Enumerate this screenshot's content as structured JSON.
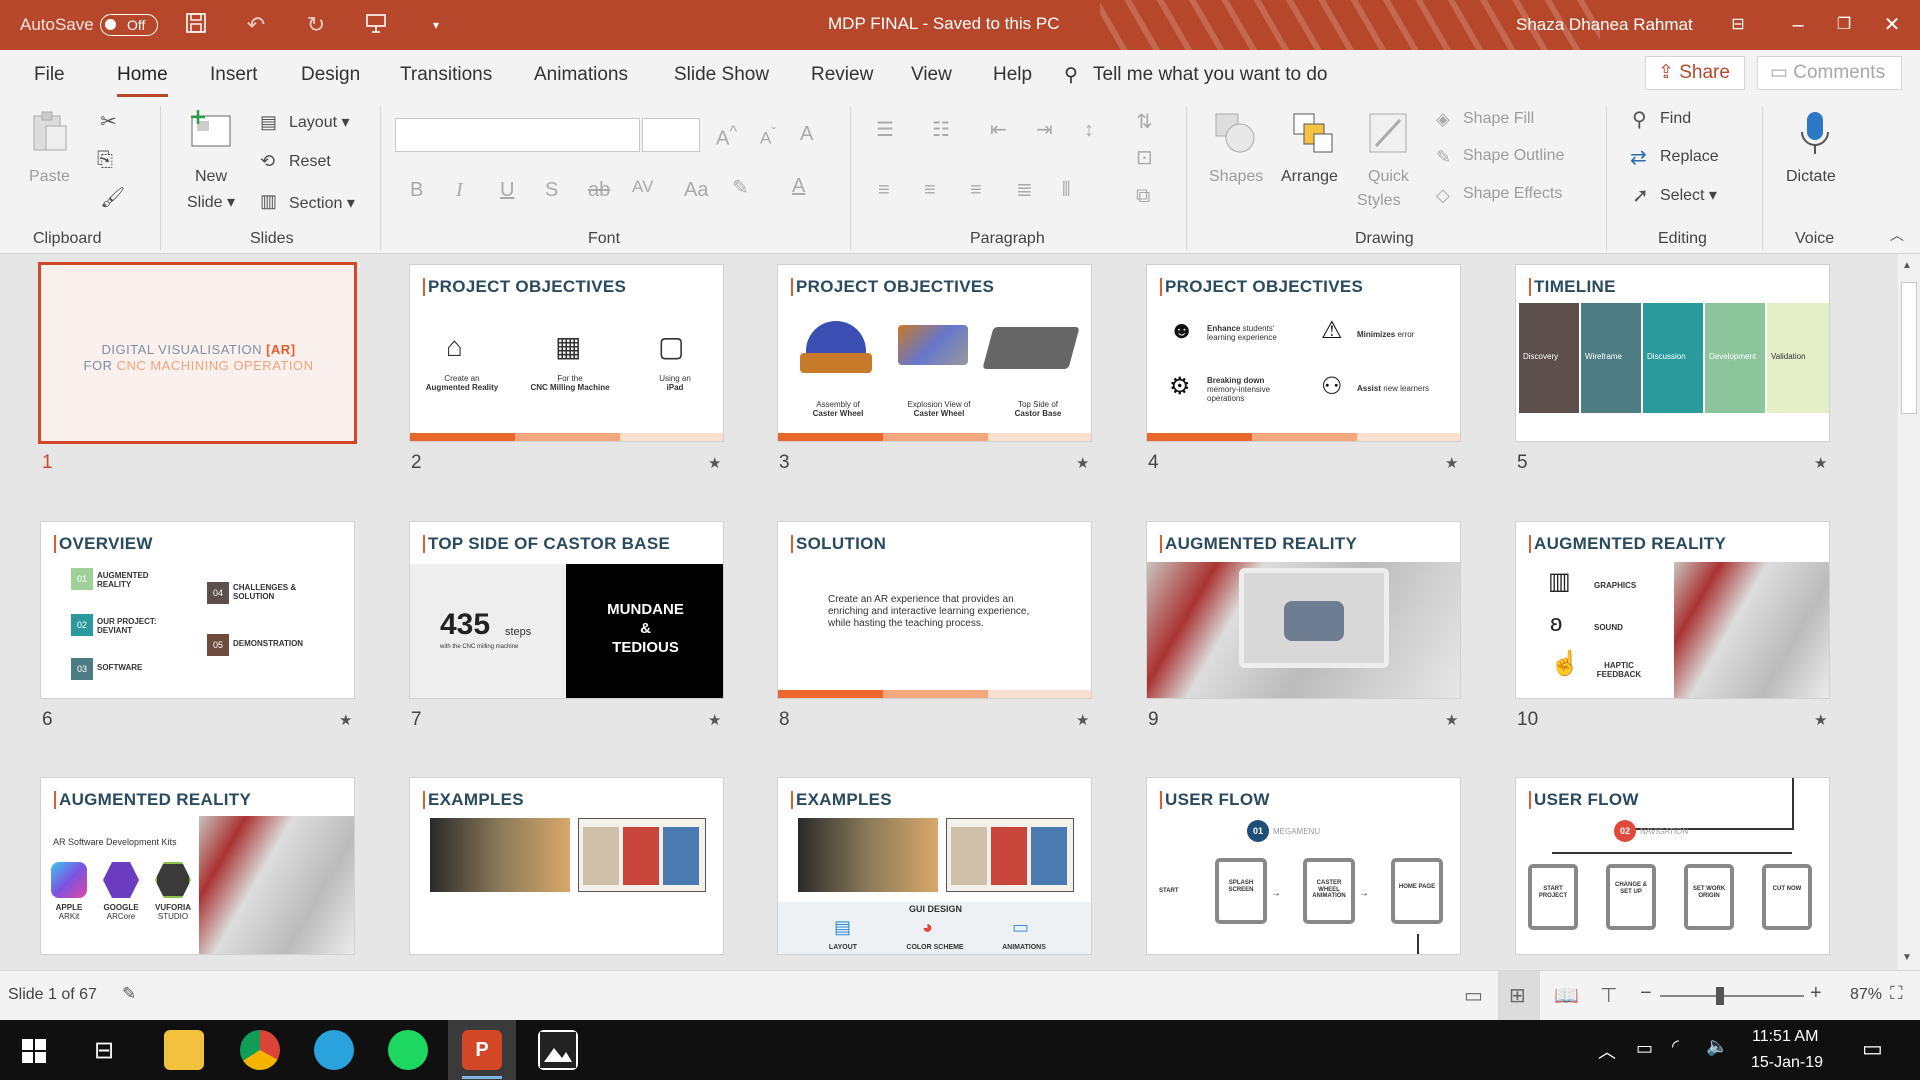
{
  "titlebar": {
    "autosave_label": "AutoSave",
    "autosave_state": "Off",
    "document_title": "MDP FINAL  -  Saved to this PC",
    "user_name": "Shaza Dhanea Rahmat",
    "bg_color": "#b7472a"
  },
  "menu": {
    "tabs": [
      "File",
      "Home",
      "Insert",
      "Design",
      "Transitions",
      "Animations",
      "Slide Show",
      "Review",
      "View",
      "Help"
    ],
    "active_tab": "Home",
    "tell_me": "Tell me what you want to do",
    "share": "Share",
    "comments": "Comments"
  },
  "ribbon": {
    "clipboard": {
      "paste": "Paste",
      "group": "Clipboard"
    },
    "slides": {
      "new_slide_1": "New",
      "new_slide_2": "Slide",
      "layout": "Layout",
      "reset": "Reset",
      "section": "Section",
      "group": "Slides"
    },
    "font": {
      "bold": "B",
      "italic": "I",
      "underline": "U",
      "shadow": "S",
      "strike": "ab",
      "group": "Font"
    },
    "paragraph": {
      "group": "Paragraph"
    },
    "drawing": {
      "shapes": "Shapes",
      "arrange": "Arrange",
      "quick_styles_1": "Quick",
      "quick_styles_2": "Styles",
      "shape_fill": "Shape Fill",
      "shape_outline": "Shape Outline",
      "shape_effects": "Shape Effects",
      "group": "Drawing"
    },
    "editing": {
      "find": "Find",
      "replace": "Replace",
      "select": "Select",
      "group": "Editing"
    },
    "voice": {
      "dictate": "Dictate",
      "group": "Voice"
    }
  },
  "slides": [
    {
      "num": "1",
      "line1a": "DIGITAL VISUALISATION ",
      "line1b": "[AR]",
      "line2a": "FOR ",
      "line2b": "CNC MACHINING OPERATION"
    },
    {
      "num": "2",
      "title": "PROJECT OBJECTIVES",
      "items": [
        [
          "Create an",
          "Augmented Reality"
        ],
        [
          "For the",
          "CNC Milling Machine"
        ],
        [
          "Using an",
          "iPad"
        ]
      ]
    },
    {
      "num": "3",
      "title": "PROJECT OBJECTIVES",
      "items": [
        [
          "Assembly of",
          "Caster Wheel"
        ],
        [
          "Explosion View of",
          "Caster Wheel"
        ],
        [
          "Top Side of",
          "Castor Base"
        ]
      ]
    },
    {
      "num": "4",
      "title": "PROJECT OBJECTIVES",
      "items": [
        [
          "Enhance",
          " students' learning experience"
        ],
        [
          "Minimizes",
          " error"
        ],
        [
          "Breaking down",
          " memory-intensive operations"
        ],
        [
          "Assist",
          " new learners"
        ]
      ]
    },
    {
      "num": "5",
      "title": "TIMELINE",
      "items": [
        "Discovery",
        "Wireframe",
        "Discussion",
        "Development",
        "Validation"
      ]
    },
    {
      "num": "6",
      "title": "OVERVIEW",
      "items": [
        [
          "01",
          "AUGMENTED REALITY"
        ],
        [
          "02",
          "OUR PROJECT: DEVIANT"
        ],
        [
          "03",
          "SOFTWARE"
        ],
        [
          "04",
          "CHALLENGES & SOLUTION"
        ],
        [
          "05",
          "DEMONSTRATION"
        ]
      ]
    },
    {
      "num": "7",
      "title": "TOP SIDE OF CASTOR BASE",
      "big": "435",
      "unit": "steps",
      "sub": "with the CNC milling machine",
      "right1": "MUNDANE",
      "right2": "&",
      "right3": "TEDIOUS"
    },
    {
      "num": "8",
      "title": "SOLUTION",
      "text": "Create an AR experience that provides an enriching and interactive learning experience, while hasting the teaching process."
    },
    {
      "num": "9",
      "title": "AUGMENTED REALITY"
    },
    {
      "num": "10",
      "title": "AUGMENTED REALITY",
      "items": [
        "GRAPHICS",
        "SOUND",
        "HAPTIC FEEDBACK"
      ]
    },
    {
      "num": "11",
      "title": "AUGMENTED REALITY",
      "kits": "AR Software Development Kits",
      "items": [
        [
          "APPLE",
          "ARKit"
        ],
        [
          "GOOGLE",
          "ARCore"
        ],
        [
          "VUFORIA",
          "STUDIO"
        ]
      ]
    },
    {
      "num": "12",
      "title": "EXAMPLES"
    },
    {
      "num": "13",
      "title": "EXAMPLES",
      "gui": "GUI DESIGN",
      "items": [
        "LAYOUT",
        "COLOR SCHEME",
        "ANIMATIONS"
      ]
    },
    {
      "num": "14",
      "title": "USER FLOW",
      "badge": "01",
      "badge_label": "MEGAMENU",
      "start": "START",
      "screens": [
        "SPLASH SCREEN",
        "CASTER WHEEL ANIMATION",
        "HOME PAGE"
      ]
    },
    {
      "num": "15",
      "title": "USER FLOW",
      "badge": "02",
      "badge_label": "NAVIGATION",
      "screens": [
        "START PROJECT",
        "CHANGE & SET UP",
        "SET WORK ORIGIN",
        "CUT NOW"
      ]
    }
  ],
  "status": {
    "slide_count": "Slide 1 of 67",
    "zoom": "87%"
  },
  "taskbar": {
    "time": "11:51 AM",
    "date": "15-Jan-19"
  }
}
